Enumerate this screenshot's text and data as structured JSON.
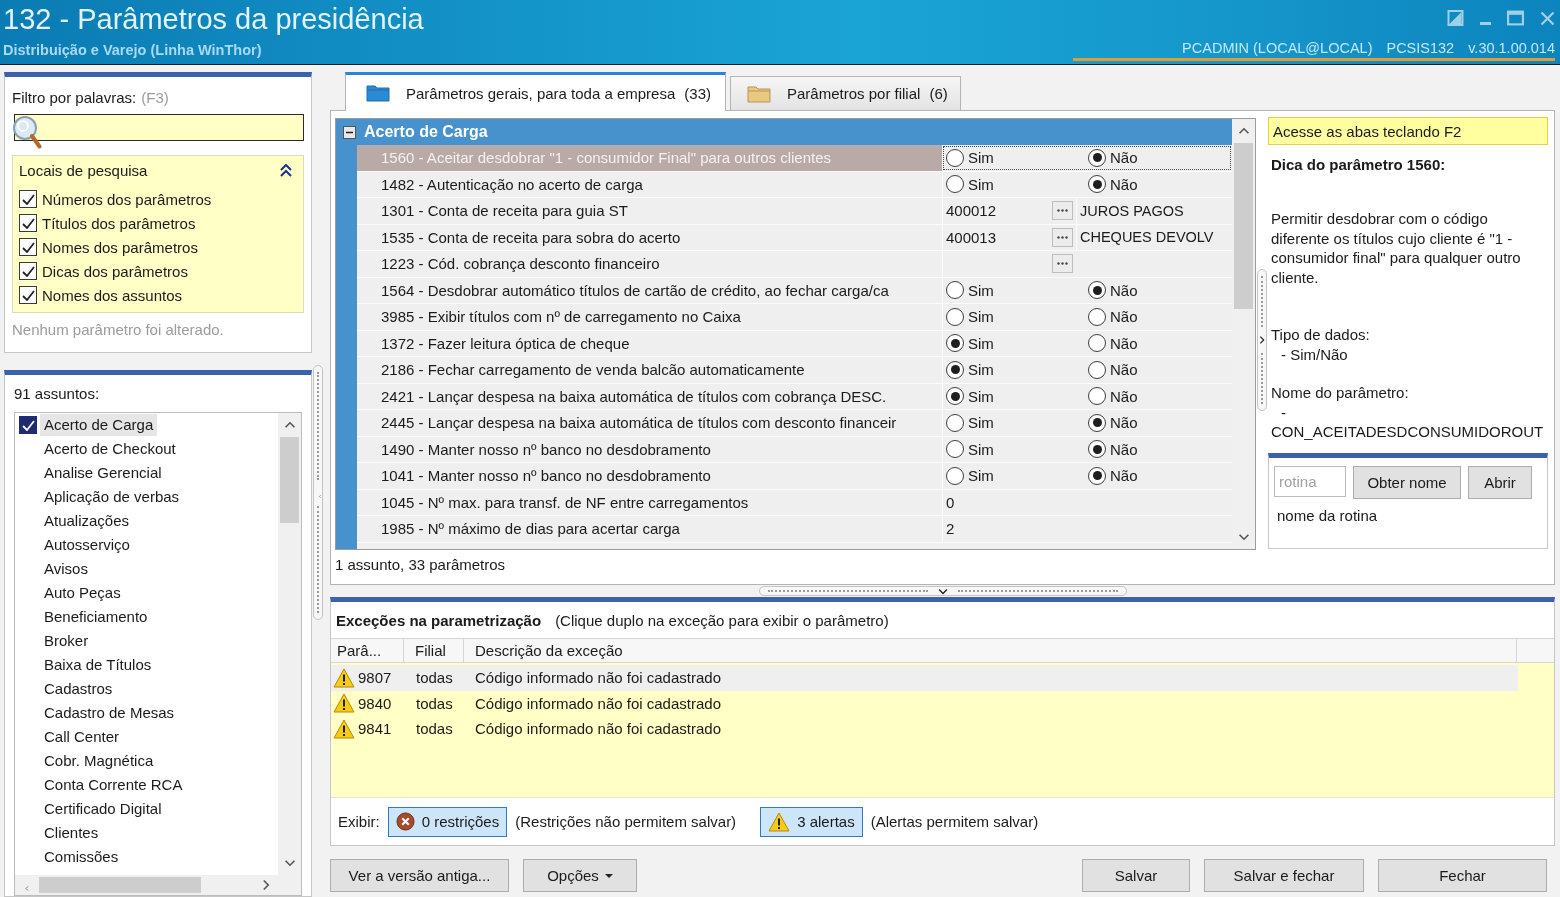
{
  "window": {
    "title": "132 - Parâmetros da presidência",
    "subtitle": "Distribuição e Varejo (Linha WinThor)",
    "user": "PCADMIN (LOCAL@LOCAL)",
    "program": "PCSIS132",
    "version": "v.30.1.00.014"
  },
  "filter": {
    "label": "Filtro por palavras:",
    "shortcut": "(F3)",
    "search_places": {
      "title": "Locais de pesquisa",
      "expanded": true,
      "options": [
        {
          "label": "Números dos parâmetros",
          "checked": true
        },
        {
          "label": "Títulos dos parâmetros",
          "checked": true
        },
        {
          "label": "Nomes dos parâmetros",
          "checked": true
        },
        {
          "label": "Dicas dos parâmetros",
          "checked": true
        },
        {
          "label": "Nomes dos assuntos",
          "checked": true
        }
      ]
    },
    "status": "Nenhum parâmetro foi alterado."
  },
  "subjects": {
    "count_label": "91 assuntos:",
    "items": [
      {
        "label": "Acerto de Carga",
        "checked": true,
        "selected": true
      },
      {
        "label": "Acerto de Checkout",
        "checked": false,
        "selected": false
      },
      {
        "label": "Analise Gerencial",
        "checked": false,
        "selected": false
      },
      {
        "label": "Aplicação de verbas",
        "checked": false,
        "selected": false
      },
      {
        "label": "Atualizações",
        "checked": false,
        "selected": false
      },
      {
        "label": "Autosserviço",
        "checked": false,
        "selected": false
      },
      {
        "label": "Avisos",
        "checked": false,
        "selected": false
      },
      {
        "label": "Auto Peças",
        "checked": false,
        "selected": false
      },
      {
        "label": "Beneficiamento",
        "checked": false,
        "selected": false
      },
      {
        "label": "Broker",
        "checked": false,
        "selected": false
      },
      {
        "label": "Baixa de Títulos",
        "checked": false,
        "selected": false
      },
      {
        "label": "Cadastros",
        "checked": false,
        "selected": false
      },
      {
        "label": "Cadastro de Mesas",
        "checked": false,
        "selected": false
      },
      {
        "label": "Call Center",
        "checked": false,
        "selected": false
      },
      {
        "label": "Cobr. Magnética",
        "checked": false,
        "selected": false
      },
      {
        "label": "Conta Corrente RCA",
        "checked": false,
        "selected": false
      },
      {
        "label": "Certificado Digital",
        "checked": false,
        "selected": false
      },
      {
        "label": "Clientes",
        "checked": false,
        "selected": false
      },
      {
        "label": "Comissões",
        "checked": false,
        "selected": false
      }
    ]
  },
  "tabs": [
    {
      "label": "Parâmetros gerais, para toda a empresa",
      "count": "(33)",
      "selected": true
    },
    {
      "label": "Parâmetros por filial",
      "count": "(6)",
      "selected": false
    }
  ],
  "grid": {
    "group": {
      "title": "Acerto de Carga",
      "expanded": true
    },
    "rows": [
      {
        "kind": "yesno",
        "label": "1560 - Aceitar desdobrar \"1 - consumidor Final\" para outros clientes",
        "selected": true,
        "options": [
          {
            "label": "Sim",
            "selected": false
          },
          {
            "label": "Não",
            "selected": true
          }
        ]
      },
      {
        "kind": "yesno",
        "label": "1482 - Autenticação no acerto de carga",
        "selected": false,
        "options": [
          {
            "label": "Sim",
            "selected": false
          },
          {
            "label": "Não",
            "selected": true
          }
        ]
      },
      {
        "kind": "lookup",
        "label": "1301 - Conta de receita para guia ST",
        "selected": false,
        "code": "400012",
        "description": "JUROS PAGOS"
      },
      {
        "kind": "lookup",
        "label": "1535 - Conta de receita para sobra do acerto",
        "selected": false,
        "code": "400013",
        "description": "CHEQUES DEVOLV"
      },
      {
        "kind": "lookup",
        "label": "1223 - Cód. cobrança desconto financeiro",
        "selected": false
      },
      {
        "kind": "yesno",
        "label": "1564 - Desdobrar automático títulos de cartão de crédito, ao fechar carga/ca",
        "selected": false,
        "options": [
          {
            "label": "Sim",
            "selected": false
          },
          {
            "label": "Não",
            "selected": true
          }
        ]
      },
      {
        "kind": "yesno",
        "label": "3985 - Exibir títulos com nº de carregamento no Caixa",
        "selected": false,
        "options": [
          {
            "label": "Sim",
            "selected": false
          },
          {
            "label": "Não",
            "selected": false
          }
        ]
      },
      {
        "kind": "yesno",
        "label": "1372 - Fazer leitura óptica de cheque",
        "selected": false,
        "options": [
          {
            "label": "Sim",
            "selected": true
          },
          {
            "label": "Não",
            "selected": false
          }
        ]
      },
      {
        "kind": "yesno",
        "label": "2186 - Fechar carregamento de venda balcão automaticamente",
        "selected": false,
        "options": [
          {
            "label": "Sim",
            "selected": true
          },
          {
            "label": "Não",
            "selected": false
          }
        ]
      },
      {
        "kind": "yesno",
        "label": "2421 - Lançar despesa na baixa automática de títulos com cobrança DESC.",
        "selected": false,
        "options": [
          {
            "label": "Sim",
            "selected": true
          },
          {
            "label": "Não",
            "selected": false
          }
        ]
      },
      {
        "kind": "yesno",
        "label": "2445 - Lançar despesa na baixa automática de títulos com desconto financeir",
        "selected": false,
        "options": [
          {
            "label": "Sim",
            "selected": false
          },
          {
            "label": "Não",
            "selected": true
          }
        ]
      },
      {
        "kind": "yesno",
        "label": "1490 - Manter nosso nº banco no desdobramento",
        "selected": false,
        "options": [
          {
            "label": "Sim",
            "selected": false
          },
          {
            "label": "Não",
            "selected": true
          }
        ]
      },
      {
        "kind": "yesno",
        "label": "1041 - Manter nosso nº banco no desdobramento",
        "selected": false,
        "options": [
          {
            "label": "Sim",
            "selected": false
          },
          {
            "label": "Não",
            "selected": true
          }
        ]
      },
      {
        "kind": "number",
        "label": "1045 - Nº max. para transf. de NF entre carregamentos",
        "selected": false,
        "value": "0"
      },
      {
        "kind": "number",
        "label": "1985 - Nº máximo de dias para acertar carga",
        "selected": false,
        "value": "2"
      }
    ],
    "status": "1 assunto, 33 parâmetros"
  },
  "tip": {
    "hint": "Acesse as abas teclando F2",
    "title": "Dica do parâmetro 1560:",
    "text": "Permitir desdobrar com o código diferente os títulos cujo cliente é \"1 - consumidor final\" para qualquer outro cliente.",
    "data_type_label": "Tipo de dados:",
    "data_type": "- Sim/Não",
    "name_label": "Nome do parâmetro:",
    "name_dash": "-",
    "name": "CON_ACEITADESDCONSUMIDOROUT"
  },
  "routine": {
    "placeholder": "rotina",
    "buttons": [
      "Obter nome",
      "Abrir"
    ],
    "result": "nome da rotina"
  },
  "exceptions": {
    "title": "Exceções na parametrização",
    "hint": "(Clique duplo na exceção para exibir o parâmetro)",
    "columns": [
      "Parâ...",
      "Filial",
      "Descrição da exceção"
    ],
    "rows": [
      {
        "kind": "alert",
        "param": "9807",
        "branch": "todas",
        "description": "Código informado não foi cadastrado",
        "selected": true
      },
      {
        "kind": "alert",
        "param": "9840",
        "branch": "todas",
        "description": "Código informado não foi cadastrado",
        "selected": false
      },
      {
        "kind": "alert",
        "param": "9841",
        "branch": "todas",
        "description": "Código informado não foi cadastrado",
        "selected": false
      }
    ],
    "filters_label": "Exibir:",
    "filters": [
      {
        "kind": "restriction",
        "label": "0 restrições",
        "note": "(Restrições não permitem salvar)",
        "on": true
      },
      {
        "kind": "alert",
        "label": "3 alertas",
        "note": "(Alertas permitem salvar)",
        "on": true
      }
    ]
  },
  "buttons": {
    "left": [
      {
        "label": "Ver a versão antiga...",
        "kind": "plain"
      },
      {
        "label": "Opções",
        "kind": "menu"
      }
    ],
    "right": [
      "Salvar",
      "Salvar e fechar",
      "Fechar"
    ]
  }
}
